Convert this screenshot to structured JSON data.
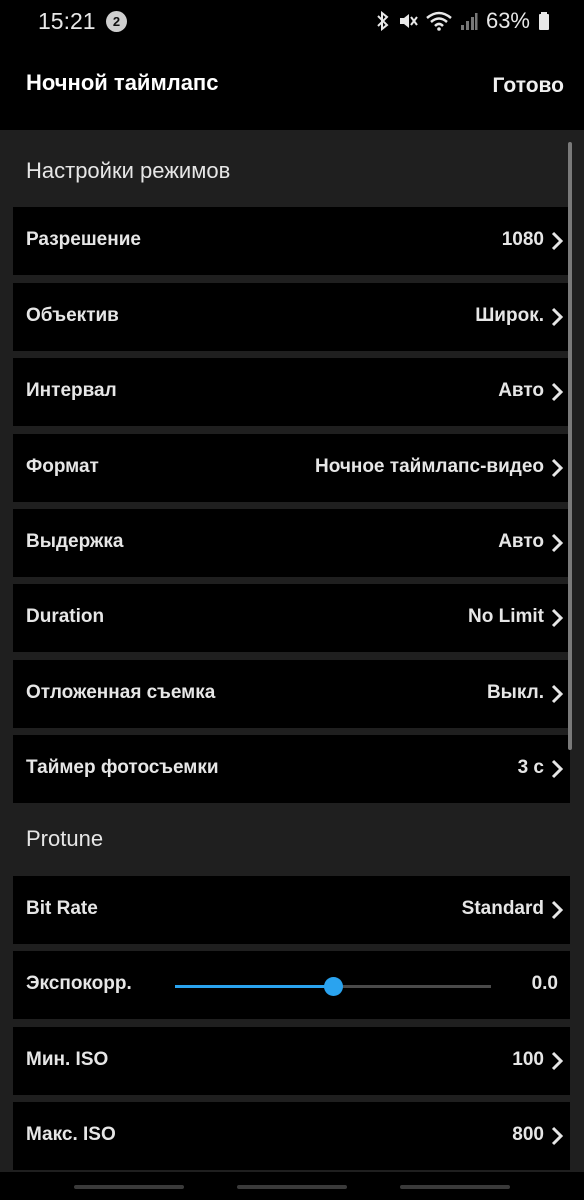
{
  "status": {
    "time": "15:21",
    "notif_count": "2",
    "battery": "63%",
    "icons": [
      "bluetooth-icon",
      "mute-icon",
      "wifi-icon",
      "signal-icon",
      "battery-icon"
    ]
  },
  "header": {
    "title": "Ночной таймлапс",
    "done": "Готово"
  },
  "sections": {
    "modes_title": "Настройки режимов",
    "protune_title": "Protune"
  },
  "modes": [
    {
      "label": "Разрешение",
      "value": "1080"
    },
    {
      "label": "Объектив",
      "value": "Широк."
    },
    {
      "label": "Интервал",
      "value": "Авто"
    },
    {
      "label": "Формат",
      "value": "Ночное таймлапс-видео"
    },
    {
      "label": "Выдержка",
      "value": "Авто"
    },
    {
      "label": "Duration",
      "value": "No Limit"
    },
    {
      "label": "Отложенная съемка",
      "value": "Выкл."
    },
    {
      "label": "Таймер фотосъемки",
      "value": "3 с"
    }
  ],
  "protune": {
    "bitrate": {
      "label": "Bit Rate",
      "value": "Standard"
    },
    "ev": {
      "label": "Экспокорр.",
      "value": "0.0",
      "slider_fraction": 0.5
    },
    "iso_min": {
      "label": "Мин. ISO",
      "value": "100"
    },
    "iso_max": {
      "label": "Макс. ISO",
      "value": "800"
    }
  },
  "colors": {
    "accent": "#2aa3ef",
    "row_bg": "#000000",
    "page_bg": "#1f1f1f"
  }
}
